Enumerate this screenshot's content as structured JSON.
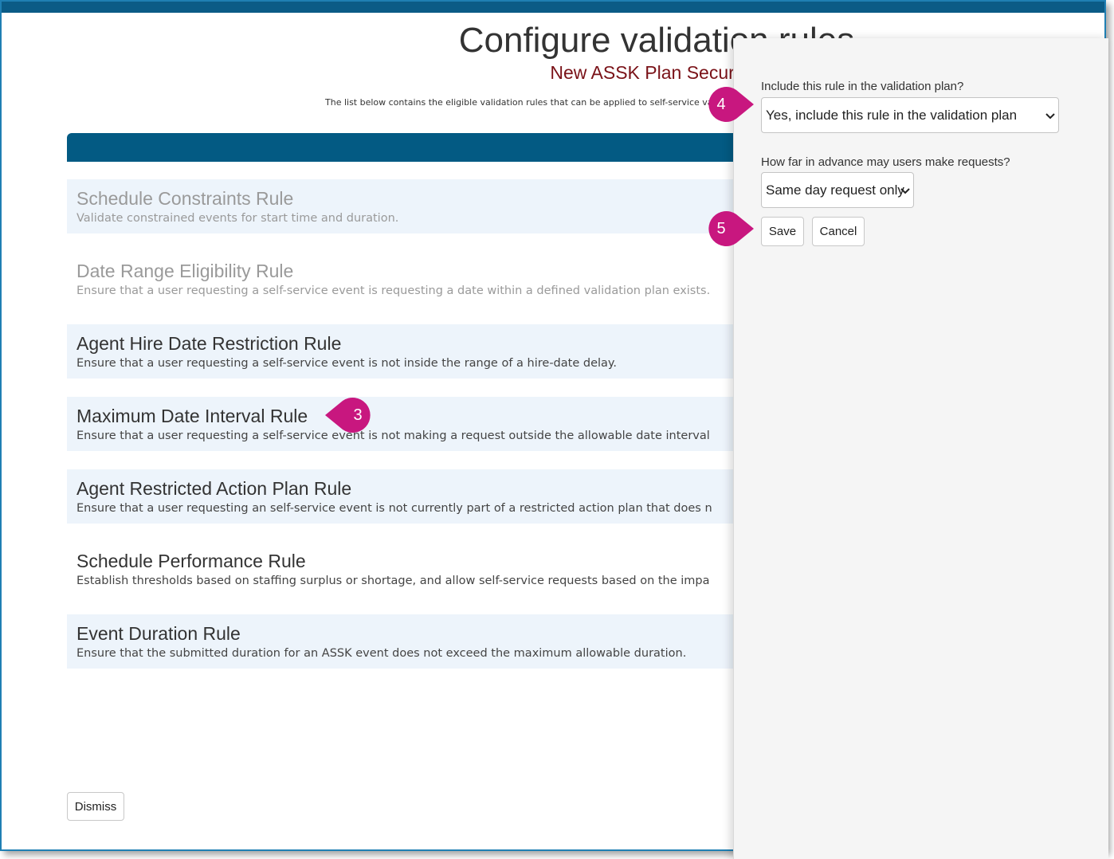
{
  "page": {
    "title": "Configure validation rules",
    "subtitle": "New ASSK Plan Security t",
    "description": "The list below contains the eligible validation rules that can be applied to self-service valid"
  },
  "rules": [
    {
      "title": "Schedule Constraints Rule",
      "description": "Validate constrained events for start time and duration."
    },
    {
      "title": "Date Range Eligibility Rule",
      "description": "Ensure that a user requesting a self-service event is requesting a date within a defined validation plan exists."
    },
    {
      "title": "Agent Hire Date Restriction Rule",
      "description": "Ensure that a user requesting a self-service event is not inside the range of a hire-date delay."
    },
    {
      "title": "Maximum Date Interval Rule",
      "description": "Ensure that a user requesting a self-service event is not making a request outside the allowable date interval"
    },
    {
      "title": "Agent Restricted Action Plan Rule",
      "description": "Ensure that a user requesting an self-service event is not currently part of a restricted action plan that does n"
    },
    {
      "title": "Schedule Performance Rule",
      "description": "Establish thresholds based on staffing surplus or shortage, and allow self-service requests based on the impa"
    },
    {
      "title": "Event Duration Rule",
      "description": "Ensure that the submitted duration for an ASSK event does not exceed the maximum allowable duration."
    }
  ],
  "footer": {
    "dismiss_label": "Dismiss"
  },
  "panel": {
    "include_label": "Include this rule in the validation plan?",
    "include_value": "Yes, include this rule in the validation plan",
    "advance_label": "How far in advance may users make requests?",
    "advance_value": "Same day request only",
    "save_label": "Save",
    "cancel_label": "Cancel"
  },
  "callouts": {
    "rule_step": "3",
    "include_step": "4",
    "save_step": "5"
  },
  "colors": {
    "header_blue": "#035a83",
    "accent_border": "#1f7fb3",
    "callout_magenta": "#c8177f",
    "subtitle_red": "#7a1218"
  }
}
